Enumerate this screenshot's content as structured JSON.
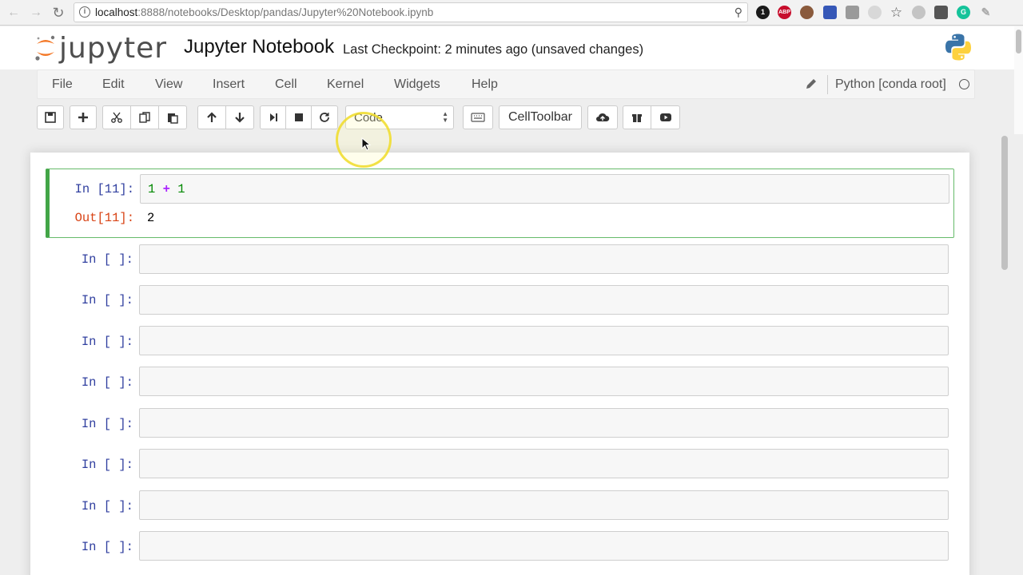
{
  "browser": {
    "url_host": "localhost",
    "url_path": ":8888/notebooks/Desktop/pandas/Jupyter%20Notebook.ipynb",
    "extensions": [
      {
        "name": "1password-icon",
        "label": "1",
        "color": "#1a1a1a"
      },
      {
        "name": "adblock-icon",
        "label": "ABP",
        "color": "#c70d2c"
      },
      {
        "name": "profile-icon",
        "label": "",
        "color": "#8a5a3c"
      },
      {
        "name": "extension-icon",
        "label": "",
        "color": "#3557b7"
      },
      {
        "name": "extension-icon",
        "label": "",
        "color": "#9a9a9a"
      },
      {
        "name": "cloud-icon",
        "label": "",
        "color": "#b5b5b5"
      },
      {
        "name": "star-icon",
        "label": "☆",
        "color": "#ffffff"
      },
      {
        "name": "glasses-icon",
        "label": "",
        "color": "#b0b0b0"
      },
      {
        "name": "menu-grid-icon",
        "label": "",
        "color": "#555555"
      },
      {
        "name": "grammarly-icon",
        "label": "G",
        "color": "#15c39a"
      },
      {
        "name": "pen-icon",
        "label": "",
        "color": "#c8c8c8"
      }
    ]
  },
  "header": {
    "logo_text": "jupyter",
    "notebook_name": "Jupyter Notebook",
    "checkpoint": "Last Checkpoint: 2 minutes ago (unsaved changes)"
  },
  "menu": {
    "items": [
      "File",
      "Edit",
      "View",
      "Insert",
      "Cell",
      "Kernel",
      "Widgets",
      "Help"
    ],
    "kernel_name": "Python [conda root]"
  },
  "toolbar": {
    "cell_type": "Code",
    "celltoolbar_label": "CellToolbar"
  },
  "cells": [
    {
      "in_prompt": "In [11]:",
      "out_prompt": "Out[11]:",
      "code_a": "1",
      "code_op": "+",
      "code_b": "1",
      "output": "2"
    },
    {
      "in_prompt": "In [ ]:"
    },
    {
      "in_prompt": "In [ ]:"
    },
    {
      "in_prompt": "In [ ]:"
    },
    {
      "in_prompt": "In [ ]:"
    },
    {
      "in_prompt": "In [ ]:"
    },
    {
      "in_prompt": "In [ ]:"
    },
    {
      "in_prompt": "In [ ]:"
    },
    {
      "in_prompt": "In [ ]:"
    }
  ],
  "colors": {
    "accent_selected": "#42a547",
    "prompt_in": "#303f9f",
    "prompt_out": "#d84315"
  }
}
